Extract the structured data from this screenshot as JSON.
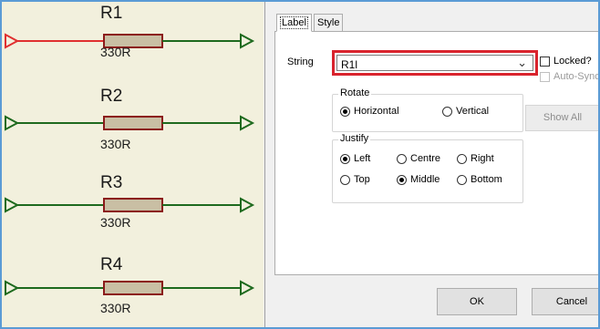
{
  "schematic": {
    "resistors": [
      {
        "ref": "R1",
        "value": "330R",
        "wire_color": "#e03030"
      },
      {
        "ref": "R2",
        "value": "330R",
        "wire_color": "#1e6a1e"
      },
      {
        "ref": "R3",
        "value": "330R",
        "wire_color": "#1e6a1e"
      },
      {
        "ref": "R4",
        "value": "330R",
        "wire_color": "#1e6a1e"
      }
    ],
    "body_color": "#c9bfa4",
    "body_outline": "#8b1a1a",
    "background": "#f2f0dd"
  },
  "dialog": {
    "tabs": {
      "label": "Label",
      "style": "Style"
    },
    "string": {
      "label": "String",
      "value": "R1l",
      "highlight_color": "#d9232d"
    },
    "locked_label": "Locked?",
    "auto_sync_label": "Auto-Sync",
    "show_all_label": "Show All",
    "rotate": {
      "title": "Rotate",
      "horizontal": "Horizontal",
      "vertical": "Vertical",
      "selected": "Horizontal"
    },
    "justify": {
      "title": "Justify",
      "left": "Left",
      "centre": "Centre",
      "right": "Right",
      "top": "Top",
      "middle": "Middle",
      "bottom": "Bottom",
      "selected_horizontal": "Left",
      "selected_vertical": "Middle"
    },
    "ok_label": "OK",
    "cancel_label": "Cancel"
  }
}
